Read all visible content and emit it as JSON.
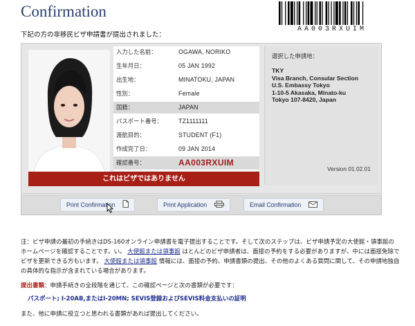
{
  "page": {
    "title": "Confirmation",
    "barcode_text": "AA003RXUIM",
    "intro": "下記の方の非移民ビザ申請書が提出されました："
  },
  "applicant": {
    "rows": [
      {
        "label": "入力した名前：",
        "value": "OGAWA, NORIKO"
      },
      {
        "label": "生年月日：",
        "value": "05 JAN 1992"
      },
      {
        "label": "出生地：",
        "value": "MINATOKU, JAPAN"
      },
      {
        "label": "性別：",
        "value": "Female"
      },
      {
        "label": "国籍：",
        "value": "JAPAN"
      },
      {
        "label": "パスポート番号：",
        "value": "TZ1111111"
      },
      {
        "label": "渡航目的：",
        "value": "STUDENT (F1)"
      },
      {
        "label": "作成完了日：",
        "value": "09 JAN 2014"
      },
      {
        "label": "確認番号：",
        "value": "AA003RXUIM"
      }
    ],
    "notice": "これはビザではありません"
  },
  "location": {
    "label": "選択した申請地：",
    "lines": [
      "TKY",
      "Visa Branch, Consular Section",
      "U.S. Embassy Tokyo",
      "1-10-5 Akasaka, Minato-ku",
      "Tokyo 107-8420, Japan"
    ],
    "version": "Version 01.02.01"
  },
  "buttons": {
    "print_confirmation": "Print Confirmation",
    "print_application": "Print Application",
    "email_confirmation": "Email Confirmation"
  },
  "info": {
    "note_lead": "注：ビザ申請の最初の手続きはDS-160オンライン申請書を電子提出することです。そして次のステップは、ビザ申請予定の大使館・領事館のホームページを確認することです。い。",
    "link1": "大使館または領事館",
    "note_mid1": "はとんどのビザ申請者は、面接の予約をする必要がありますが、中には面接免除でビザを更新できる方もいます。",
    "link2": "大使館または領事館",
    "note_mid2": "情報には、面接の予約、申請書類の提出、その他のよくある質問に関して、その申請地独自の具体的な指示が含まれている場合があります。",
    "docs_label": "提出書類",
    "docs_text": "：申請手続きの全段階を通じて、この確認ページと次の書類が必要です：",
    "docs_list": "パスポート; I-20AB,またはI-20MN; SEVIS登録およびSEVIS料金支払いの証明",
    "footer": "また、他に申請に役立つと思われる書類があれば提出してください。"
  },
  "colors": {
    "title": "#2a3f6b",
    "notice_bg": "#a81f16",
    "confirmation_code": "#9e1b1b",
    "link": "#1a2a8a"
  },
  "icons": [
    "barcode",
    "applicant-photo",
    "document-icon",
    "printer-icon",
    "envelope-icon",
    "mouse-pointer-icon"
  ]
}
